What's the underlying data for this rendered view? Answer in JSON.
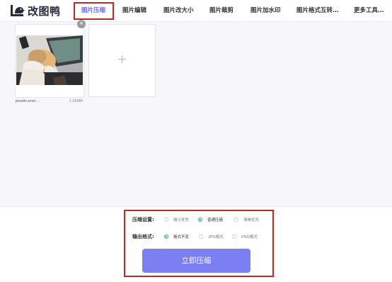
{
  "brand": {
    "name": "改图鸭"
  },
  "nav": {
    "items": [
      {
        "label": "图片压缩",
        "active": true
      },
      {
        "label": "图片编辑"
      },
      {
        "label": "图片改大小"
      },
      {
        "label": "图片裁剪"
      },
      {
        "label": "图片加水印"
      },
      {
        "label": "图片格式互转…"
      },
      {
        "label": "更多工具…"
      }
    ]
  },
  "upload": {
    "files": [
      {
        "name": "pexels-ener…",
        "size": "1.65MB"
      }
    ],
    "add_icon": "plus-icon",
    "remove_icon": "close-icon"
  },
  "settings": {
    "compress_label": "压缩设置:",
    "compress_options": [
      {
        "label": "缩小优先",
        "checked": false
      },
      {
        "label": "普通压缩",
        "checked": true
      },
      {
        "label": "清晰优先",
        "checked": false
      }
    ],
    "format_label": "输出格式:",
    "format_options": [
      {
        "label": "格式不变",
        "checked": true
      },
      {
        "label": "JPG格式",
        "checked": false
      },
      {
        "label": "PNG格式",
        "checked": false
      }
    ]
  },
  "actions": {
    "compress_button": "立即压缩"
  },
  "colors": {
    "accent": "#7b7ff2",
    "nav_active": "#6a6ff0",
    "radio_checked": "#22b26a",
    "highlight_frame": "#b52a2a"
  }
}
